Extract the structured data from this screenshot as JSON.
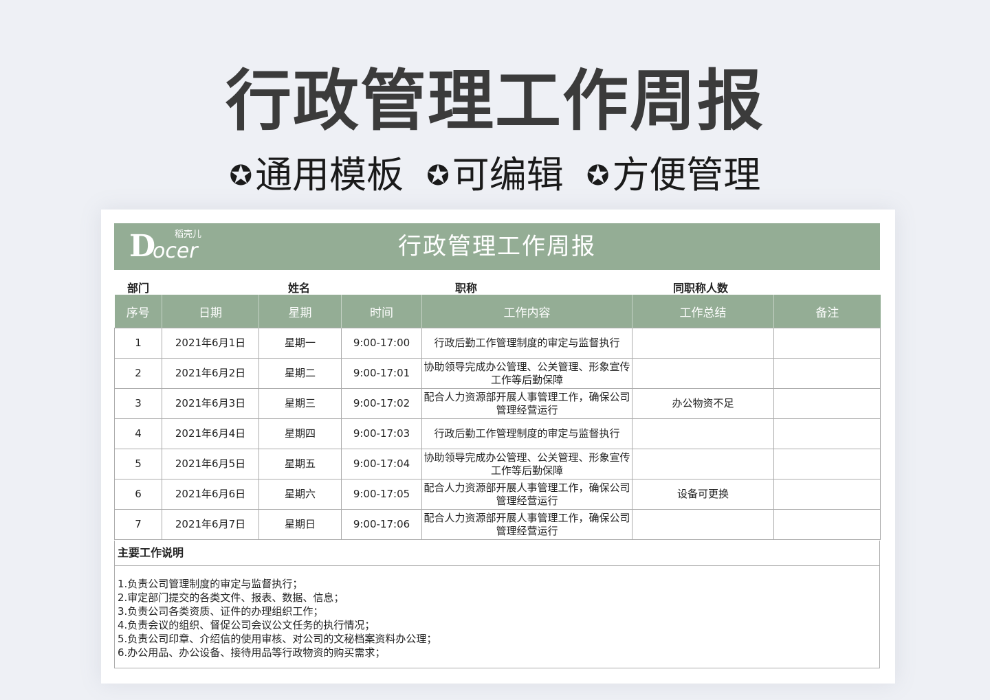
{
  "hero": {
    "title": "行政管理工作周报"
  },
  "features": [
    {
      "star": "✪",
      "label": "通用模板"
    },
    {
      "star": "✪",
      "label": "可编辑"
    },
    {
      "star": "✪",
      "label": "方便管理"
    }
  ],
  "logo": {
    "letter_d": "D",
    "text": "ocer",
    "cn": "稻壳儿"
  },
  "sheet": {
    "title": "行政管理工作周报",
    "meta": {
      "dept": "部门",
      "name": "姓名",
      "position": "职称",
      "same_title_count": "同职称人数"
    },
    "columns": [
      "序号",
      "日期",
      "星期",
      "时间",
      "工作内容",
      "工作总结",
      "备注"
    ],
    "rows": [
      {
        "no": "1",
        "date": "2021年6月1日",
        "weekday": "星期一",
        "time": "9:00-17:00",
        "content": "行政后勤工作管理制度的审定与监督执行",
        "summary": "",
        "remark": ""
      },
      {
        "no": "2",
        "date": "2021年6月2日",
        "weekday": "星期二",
        "time": "9:00-17:01",
        "content": "协助领导完成办公管理、公关管理、形象宣传工作等后勤保障",
        "summary": "",
        "remark": ""
      },
      {
        "no": "3",
        "date": "2021年6月3日",
        "weekday": "星期三",
        "time": "9:00-17:02",
        "content": "配合人力资源部开展人事管理工作，确保公司管理经营运行",
        "summary": "办公物资不足",
        "remark": ""
      },
      {
        "no": "4",
        "date": "2021年6月4日",
        "weekday": "星期四",
        "time": "9:00-17:03",
        "content": "行政后勤工作管理制度的审定与监督执行",
        "summary": "",
        "remark": ""
      },
      {
        "no": "5",
        "date": "2021年6月5日",
        "weekday": "星期五",
        "time": "9:00-17:04",
        "content": "协助领导完成办公管理、公关管理、形象宣传工作等后勤保障",
        "summary": "",
        "remark": ""
      },
      {
        "no": "6",
        "date": "2021年6月6日",
        "weekday": "星期六",
        "time": "9:00-17:05",
        "content": "配合人力资源部开展人事管理工作，确保公司管理经营运行",
        "summary": "设备可更换",
        "remark": ""
      },
      {
        "no": "7",
        "date": "2021年6月7日",
        "weekday": "星期日",
        "time": "9:00-17:06",
        "content": "配合人力资源部开展人事管理工作，确保公司管理经营运行",
        "summary": "",
        "remark": ""
      }
    ],
    "notes": {
      "heading": "主要工作说明",
      "items": [
        "1.负责公司管理制度的审定与监督执行；",
        "2.审定部门提交的各类文件、报表、数据、信息；",
        "3.负责公司各类资质、证件的办理组织工作；",
        "4.负责会议的组织、督促公司会议公文任务的执行情况；",
        "5.负责公司印章、介绍信的使用审核、对公司的文秘档案资料办公理；",
        "6.办公用品、办公设备、接待用品等行政物资的购买需求；"
      ]
    }
  }
}
